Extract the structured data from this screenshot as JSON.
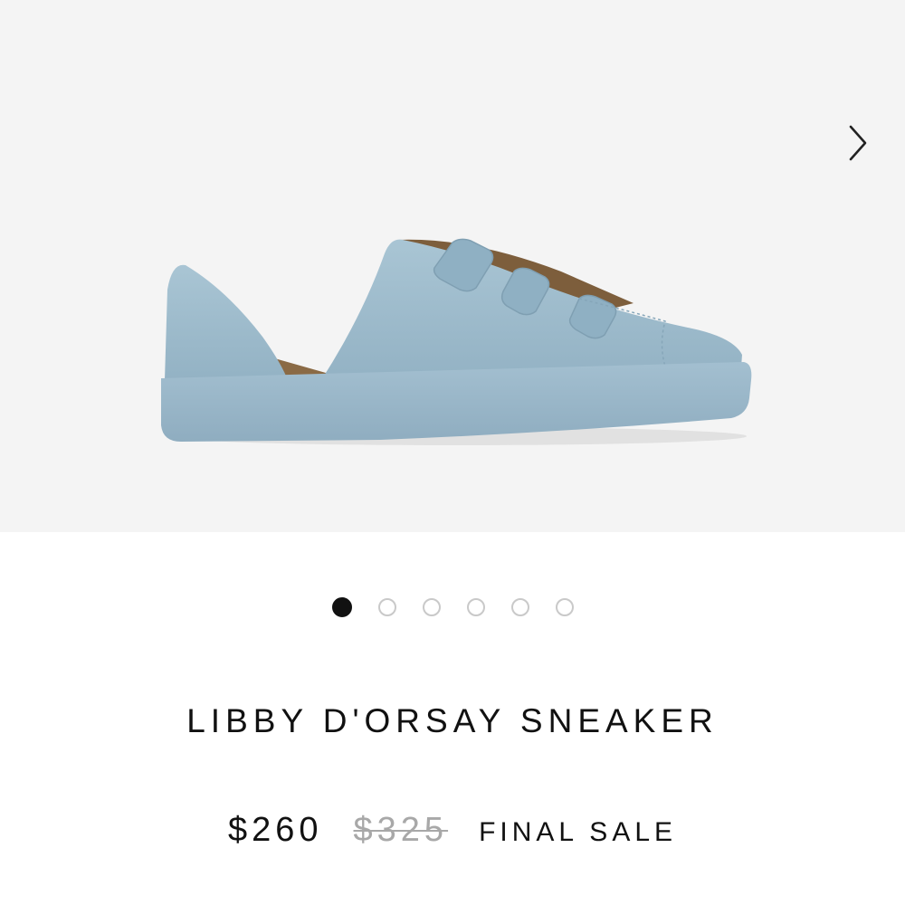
{
  "gallery": {
    "image_alt": "Light blue suede d'Orsay sneaker with three hook-and-loop straps",
    "next_icon": "chevron-right-icon",
    "background_color": "#f4f4f4",
    "shoe_color": "#9fbccd",
    "slides_count": 6,
    "active_slide": 1
  },
  "product": {
    "title": "LIBBY D'ORSAY SNEAKER",
    "price_sale": "$260",
    "price_original": "$325",
    "badge": "FINAL SALE"
  }
}
